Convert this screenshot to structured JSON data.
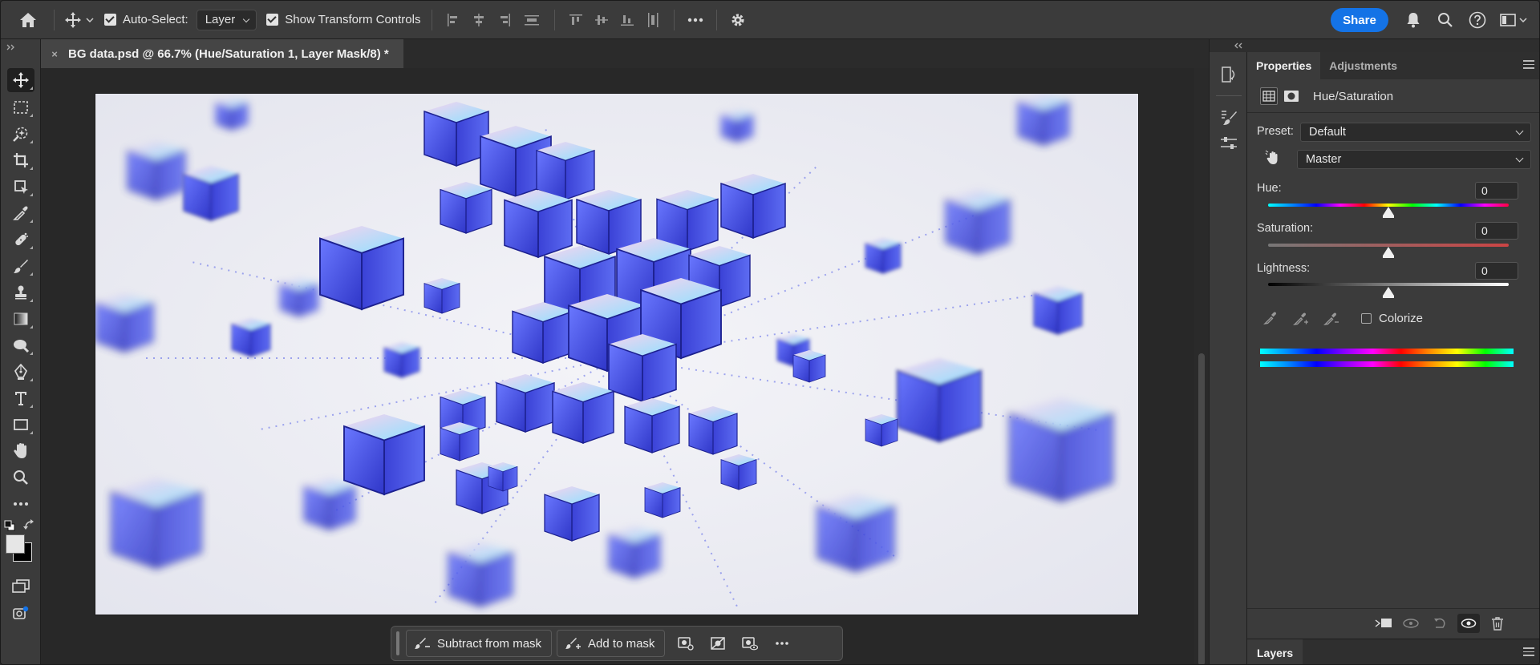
{
  "options_bar": {
    "auto_select_label": "Auto-Select:",
    "auto_select_value": "Layer",
    "show_transform_label": "Show Transform Controls",
    "share_label": "Share"
  },
  "document_tab": {
    "title": "BG data.psd @ 66.7% (Hue/Saturation 1, Layer Mask/8) *"
  },
  "task_bar": {
    "subtract_label": "Subtract from mask",
    "add_label": "Add to mask"
  },
  "properties": {
    "tabs": [
      "Properties",
      "Adjustments"
    ],
    "header_title": "Hue/Saturation",
    "preset_label": "Preset:",
    "preset_value": "Default",
    "channel_value": "Master",
    "hue_label": "Hue:",
    "hue_value": "0",
    "saturation_label": "Saturation:",
    "saturation_value": "0",
    "lightness_label": "Lightness:",
    "lightness_value": "0",
    "colorize_label": "Colorize",
    "colorize_checked": false,
    "layers_tab": "Layers"
  },
  "colors": {
    "accent": "#1473e6",
    "ui_panel": "#3b3b3b",
    "ui_dark": "#282828",
    "cube_blue": "#4a55e8",
    "cube_pink": "#f0c8e8",
    "canvas_bg": "#ecedf2"
  }
}
